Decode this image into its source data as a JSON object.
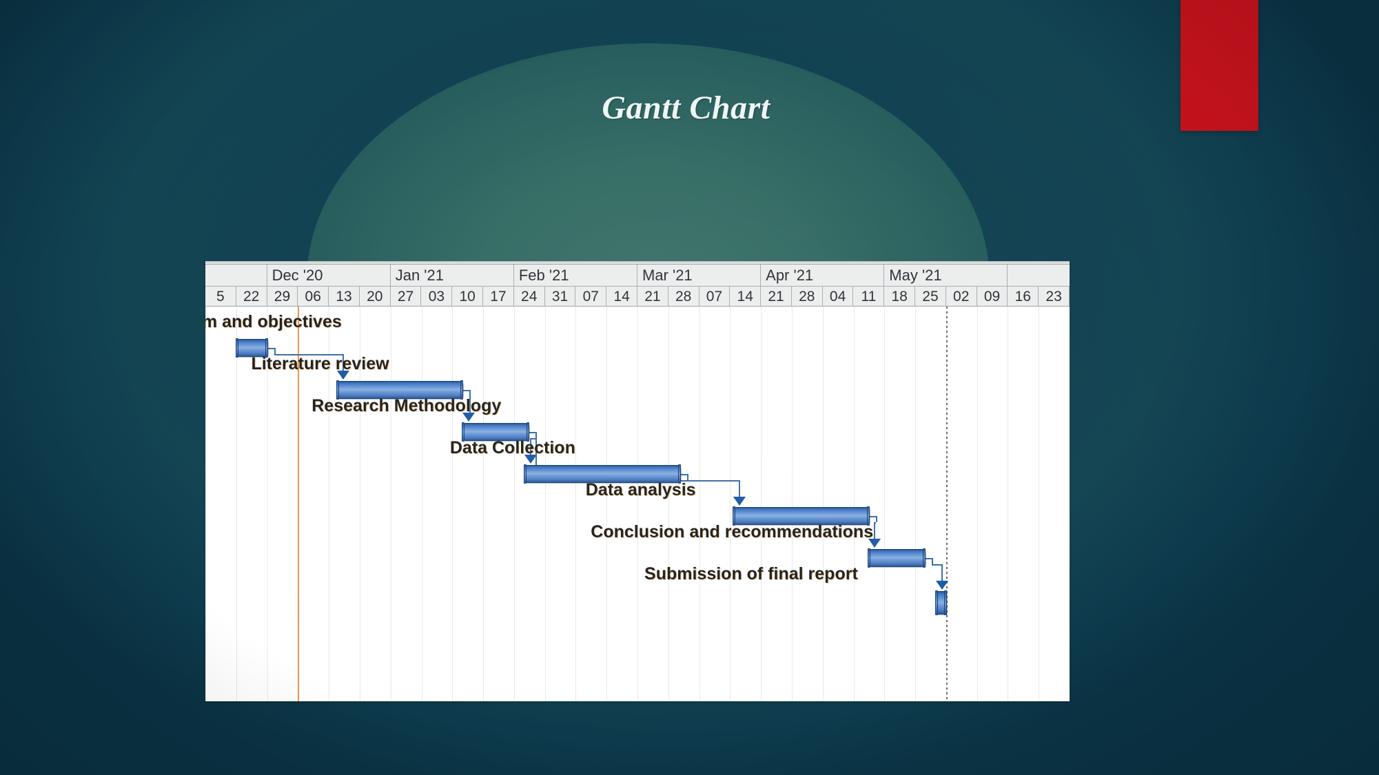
{
  "slide": {
    "title": "Gantt Chart",
    "background_color_center": "#336b63",
    "background_color_edge": "#0d3a4c",
    "accent_rect_color": "#c1121c"
  },
  "chart_data": {
    "type": "bar",
    "subtype": "gantt",
    "title": "Gantt Chart",
    "xlabel": "",
    "ylabel": "",
    "grid": true,
    "legend_position": "none",
    "months": [
      {
        "label": "Dec '20",
        "left_pct": 4.94,
        "width_pct": 19.78
      },
      {
        "label": "Jan '21",
        "left_pct": 24.72,
        "width_pct": 19.78
      },
      {
        "label": "Feb '21",
        "left_pct": 44.5,
        "width_pct": 19.78
      },
      {
        "label": "Mar '21",
        "left_pct": 64.27,
        "width_pct": 19.78
      },
      {
        "label": "Apr '21",
        "left_pct": 84.05,
        "width_pct": 15.95
      },
      {
        "label": "May '21",
        "left_pct": 100.0,
        "width_pct": 19.78
      }
    ],
    "week_ticks": [
      "5",
      "22",
      "29",
      "06",
      "13",
      "20",
      "27",
      "03",
      "10",
      "17",
      "24",
      "31",
      "07",
      "14",
      "21",
      "28",
      "07",
      "14",
      "21",
      "28",
      "04",
      "11",
      "18",
      "25",
      "02",
      "09",
      "16",
      "23"
    ],
    "today_marker": {
      "label": "today",
      "color": "#f0954a",
      "week_index": 3
    },
    "status_marker": {
      "label": "status-date",
      "color": "#6b6b6b",
      "week_index": 24
    },
    "tasks": [
      {
        "name": "Aim and objectives",
        "bar_start_pct": 3.51,
        "bar_width_pct": 3.75,
        "row": 0,
        "label_left_pct": -2.4,
        "milestone": false
      },
      {
        "name": "Literature review",
        "bar_start_pct": 15.15,
        "bar_width_pct": 14.67,
        "row": 1,
        "label_left_pct": 5.3,
        "milestone": false
      },
      {
        "name": "Research Methodology",
        "bar_start_pct": 29.66,
        "bar_width_pct": 7.81,
        "row": 2,
        "label_left_pct": 12.3,
        "milestone": false
      },
      {
        "name": "Data Collection",
        "bar_start_pct": 36.84,
        "bar_width_pct": 18.18,
        "row": 3,
        "label_left_pct": 28.3,
        "milestone": false
      },
      {
        "name": "Data analysis",
        "bar_start_pct": 61.0,
        "bar_width_pct": 15.87,
        "row": 4,
        "label_left_pct": 44.0,
        "milestone": false
      },
      {
        "name": "Conclusion and recommendations",
        "bar_start_pct": 76.63,
        "bar_width_pct": 6.7,
        "row": 5,
        "label_left_pct": 44.6,
        "milestone": false
      },
      {
        "name": "Submission of final report",
        "bar_start_pct": 84.45,
        "bar_width_pct": 1.35,
        "row": 6,
        "label_left_pct": 50.8,
        "milestone": true
      }
    ],
    "dependencies": [
      {
        "from": "Aim and objectives",
        "to": "Literature review",
        "type": "finish-to-start"
      },
      {
        "from": "Literature review",
        "to": "Research Methodology",
        "type": "finish-to-start"
      },
      {
        "from": "Research Methodology",
        "to": "Data Collection",
        "type": "finish-to-start"
      },
      {
        "from": "Research Methodology",
        "to": "Data analysis",
        "type": "finish-to-start"
      },
      {
        "from": "Data Collection",
        "to": "Data analysis",
        "type": "finish-to-start"
      },
      {
        "from": "Data analysis",
        "to": "Conclusion and recommendations",
        "type": "finish-to-start"
      },
      {
        "from": "Conclusion and recommendations",
        "to": "Submission of final report",
        "type": "finish-to-start"
      }
    ],
    "bar_color": "#5b8bc9",
    "bar_border_color": "#1b4279",
    "link_color": "#3a6ea8"
  }
}
